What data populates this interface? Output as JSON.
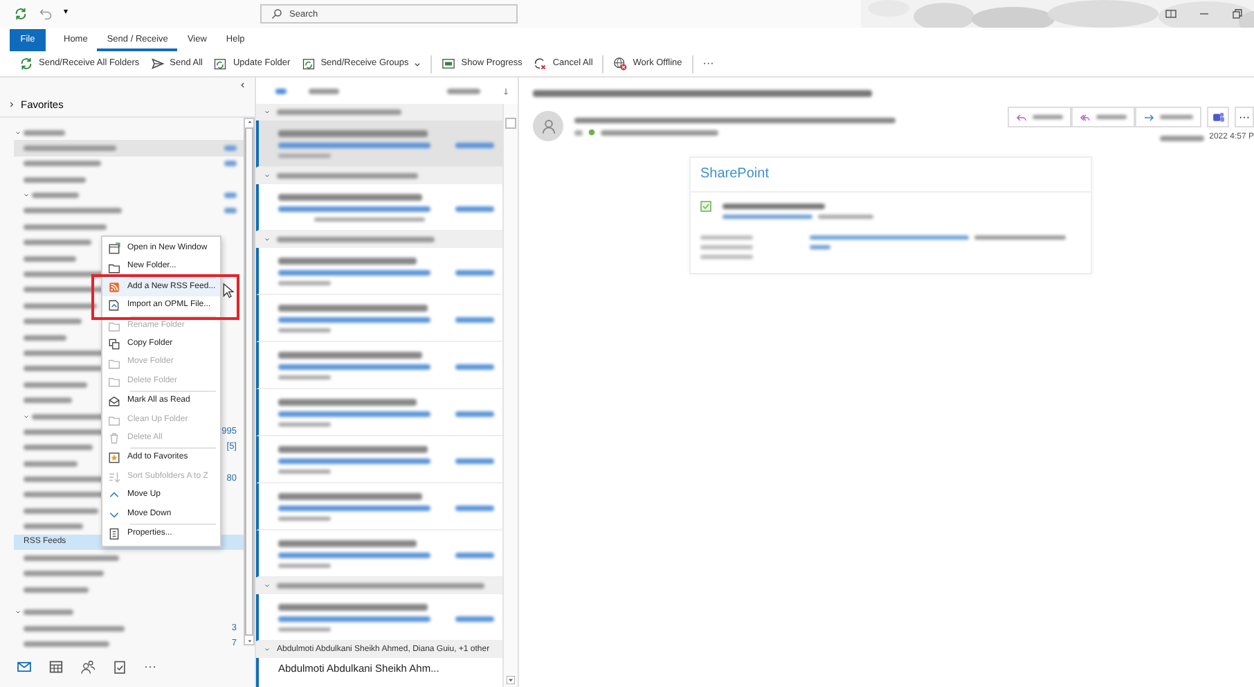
{
  "quick_access": {
    "menu": "▾"
  },
  "search": {
    "placeholder": "Search"
  },
  "ribbon_tabs": [
    {
      "label": "File",
      "kind": "file",
      "selected": false
    },
    {
      "label": "Home",
      "kind": "tab",
      "selected": false
    },
    {
      "label": "Send / Receive",
      "kind": "tab",
      "selected": true
    },
    {
      "label": "View",
      "kind": "tab",
      "selected": false
    },
    {
      "label": "Help",
      "kind": "tab",
      "selected": false
    }
  ],
  "toolbar": {
    "groups": [
      [
        {
          "kind": "sync",
          "label": "Send/Receive All Folders",
          "dropdown": false
        },
        {
          "kind": "send",
          "label": "Send All",
          "dropdown": false
        },
        {
          "kind": "update",
          "label": "Update Folder",
          "dropdown": false
        },
        {
          "kind": "groups",
          "label": "Send/Receive Groups",
          "dropdown": true
        }
      ],
      [
        {
          "kind": "progress",
          "label": "Show Progress",
          "dropdown": false
        },
        {
          "kind": "cancel",
          "label": "Cancel All",
          "dropdown": false
        }
      ],
      [
        {
          "kind": "offline",
          "label": "Work Offline",
          "dropdown": false
        }
      ]
    ],
    "more": "···"
  },
  "folder_pane": {
    "favorites": {
      "label": "Favorites",
      "expanded": false
    },
    "folders": [
      {
        "kind": "blurred",
        "expanded": true,
        "selected": false,
        "current": false,
        "children": [
          {
            "kind": "blurred",
            "selected": false,
            "current": true,
            "blurred_count": true
          },
          {
            "kind": "blurred",
            "selected": false,
            "current": false,
            "blurred_count": true
          },
          {
            "kind": "blurred",
            "selected": false,
            "current": false
          },
          {
            "kind": "blurred",
            "selected": false,
            "current": false,
            "expanded": true,
            "blurred_count": true
          },
          {
            "kind": "blurred",
            "selected": false,
            "current": false,
            "blurred_count": true
          },
          {
            "kind": "blurred",
            "selected": false,
            "current": false
          },
          {
            "kind": "blurred",
            "selected": false,
            "current": false
          },
          {
            "kind": "blurred",
            "selected": false,
            "current": false
          },
          {
            "kind": "blurred",
            "selected": false,
            "current": false
          },
          {
            "kind": "blurred",
            "selected": false,
            "current": false
          },
          {
            "kind": "blurred",
            "selected": false,
            "current": false
          },
          {
            "kind": "blurred",
            "selected": false,
            "current": false
          },
          {
            "kind": "blurred",
            "selected": false,
            "current": false
          },
          {
            "kind": "blurred",
            "selected": false,
            "current": false
          },
          {
            "kind": "blurred",
            "selected": false,
            "current": false
          },
          {
            "kind": "blurred",
            "selected": false,
            "current": false
          },
          {
            "kind": "blurred",
            "selected": false,
            "current": false
          },
          {
            "kind": "blurred",
            "selected": false,
            "current": false,
            "expanded": true
          },
          {
            "kind": "blurred",
            "selected": false,
            "current": false,
            "count": "995"
          },
          {
            "kind": "blurred",
            "selected": false,
            "current": false,
            "count": "[5]"
          },
          {
            "kind": "blurred",
            "selected": false,
            "current": false
          },
          {
            "kind": "blurred",
            "selected": false,
            "current": false,
            "count": "80"
          },
          {
            "kind": "blurred",
            "selected": false,
            "current": false
          },
          {
            "kind": "blurred",
            "selected": false,
            "current": false
          },
          {
            "kind": "blurred",
            "selected": false,
            "current": false
          },
          {
            "kind": "text",
            "label": "RSS Feeds",
            "selected": true,
            "current": false
          },
          {
            "kind": "blurred",
            "selected": false,
            "current": false
          },
          {
            "kind": "blurred",
            "selected": false,
            "current": false
          },
          {
            "kind": "blurred",
            "selected": false,
            "current": false
          }
        ]
      },
      {
        "kind": "blurred",
        "expanded": true,
        "selected": false,
        "current": false,
        "children": [
          {
            "kind": "blurred",
            "selected": false,
            "current": false,
            "count": "3"
          },
          {
            "kind": "blurred",
            "selected": false,
            "current": false,
            "count": "7"
          }
        ]
      }
    ],
    "nav": [
      {
        "kind": "mail",
        "selected": true
      },
      {
        "kind": "calendar",
        "selected": false
      },
      {
        "kind": "people",
        "selected": false
      },
      {
        "kind": "tasks",
        "selected": false
      }
    ],
    "nav_more": "···"
  },
  "context_menu": [
    {
      "kind": "item",
      "label": "Open in New Window",
      "disabled": false,
      "hovered": false
    },
    {
      "kind": "item",
      "label": "New Folder...",
      "disabled": false,
      "hovered": false
    },
    {
      "kind": "separator"
    },
    {
      "kind": "item",
      "label": "Add a New RSS Feed...",
      "disabled": false,
      "hovered": true,
      "framed": true
    },
    {
      "kind": "item",
      "label": "Import an OPML File...",
      "disabled": false,
      "hovered": false,
      "framed": true
    },
    {
      "kind": "separator"
    },
    {
      "kind": "item",
      "label": "Rename Folder",
      "disabled": true,
      "hovered": false
    },
    {
      "kind": "item",
      "label": "Copy Folder",
      "disabled": false,
      "hovered": false
    },
    {
      "kind": "item",
      "label": "Move Folder",
      "disabled": true,
      "hovered": false
    },
    {
      "kind": "item",
      "label": "Delete Folder",
      "disabled": true,
      "hovered": false
    },
    {
      "kind": "separator"
    },
    {
      "kind": "item",
      "label": "Mark All as Read",
      "disabled": false,
      "hovered": false
    },
    {
      "kind": "item",
      "label": "Clean Up Folder",
      "disabled": true,
      "hovered": false
    },
    {
      "kind": "item",
      "label": "Delete All",
      "disabled": true,
      "hovered": false
    },
    {
      "kind": "separator"
    },
    {
      "kind": "item",
      "label": "Add to Favorites",
      "disabled": false,
      "hovered": false
    },
    {
      "kind": "item",
      "label": "Sort Subfolders A to Z",
      "disabled": true,
      "hovered": false
    },
    {
      "kind": "item",
      "label": "Move Up",
      "disabled": false,
      "hovered": false
    },
    {
      "kind": "item",
      "label": "Move Down",
      "disabled": false,
      "hovered": false
    },
    {
      "kind": "separator"
    },
    {
      "kind": "item",
      "label": "Properties...",
      "disabled": false,
      "hovered": false
    }
  ],
  "message_list": {
    "filter_tabs": [
      {
        "kind": "blurred",
        "selected": true
      },
      {
        "kind": "blurred",
        "selected": false
      }
    ],
    "groups": [
      {
        "kind": "blurred",
        "expanded": true,
        "messages": [
          {
            "kind": "blurred",
            "selected": true,
            "unread": true
          }
        ]
      },
      {
        "kind": "blurred",
        "expanded": true,
        "messages": [
          {
            "kind": "blurred",
            "selected": false,
            "unread": true
          }
        ]
      },
      {
        "kind": "blurred",
        "expanded": true,
        "messages": [
          {
            "kind": "blurred",
            "selected": false,
            "unread": true
          },
          {
            "kind": "blurred",
            "selected": false,
            "unread": true
          },
          {
            "kind": "blurred",
            "selected": false,
            "unread": true
          },
          {
            "kind": "blurred",
            "selected": false,
            "unread": true
          },
          {
            "kind": "blurred",
            "selected": false,
            "unread": true
          },
          {
            "kind": "blurred",
            "selected": false,
            "unread": true
          },
          {
            "kind": "blurred",
            "selected": false,
            "unread": true
          }
        ]
      },
      {
        "kind": "blurred",
        "expanded": true,
        "messages": [
          {
            "kind": "blurred",
            "selected": false,
            "unread": true
          }
        ]
      },
      {
        "kind": "text",
        "header": "Abdulmoti Abdulkani Sheikh Ahmed, Diana Guiu, +1 other",
        "expanded": true,
        "messages": [
          {
            "kind": "text",
            "sender": "Abdulmoti Abdulkani Sheikh Ahm...",
            "selected": false,
            "unread": true
          }
        ]
      }
    ]
  },
  "reading_pane": {
    "actions": [
      {
        "kind": "reply"
      },
      {
        "kind": "reply_all"
      },
      {
        "kind": "forward"
      }
    ],
    "more": "···",
    "date": "2022 4:57 P",
    "card": {
      "title": "SharePoint"
    }
  }
}
